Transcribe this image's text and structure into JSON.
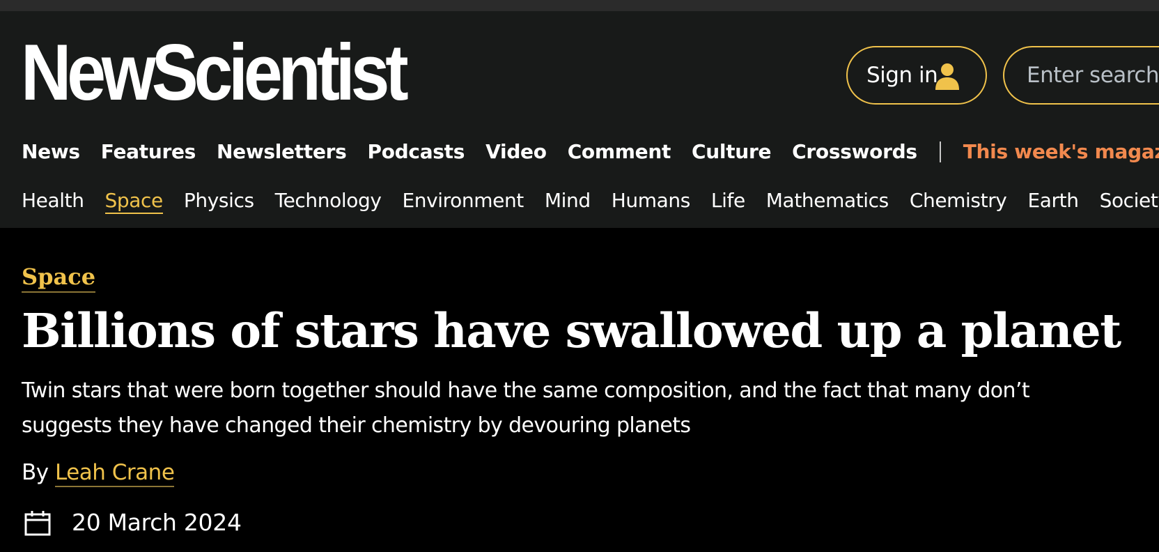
{
  "header": {
    "logo_text": "NewScientist",
    "signin_label": "Sign in",
    "search_placeholder": "Enter search keywords"
  },
  "main_nav": {
    "items": [
      "News",
      "Features",
      "Newsletters",
      "Podcasts",
      "Video",
      "Comment",
      "Culture",
      "Crosswords"
    ],
    "magazine_label": "This week's magazine"
  },
  "sub_nav": {
    "items": [
      "Health",
      "Space",
      "Physics",
      "Technology",
      "Environment",
      "Mind",
      "Humans",
      "Life",
      "Mathematics",
      "Chemistry",
      "Earth",
      "Society"
    ],
    "active": "Space"
  },
  "article": {
    "section": "Space",
    "headline": "Billions of stars have swallowed up a planet",
    "standfirst": "Twin stars that were born together should have the same composition, and the fact that many don’t suggests they have changed their chemistry by devouring planets",
    "byline_prefix": "By",
    "author": "Leah Crane",
    "date": "20 March 2024"
  },
  "icons": {
    "user": "user-icon",
    "calendar": "calendar-icon"
  },
  "colors": {
    "accent": "#f0c24b",
    "magazine": "#f2894e",
    "header_bg": "#181a19",
    "page_bg": "#000000"
  }
}
